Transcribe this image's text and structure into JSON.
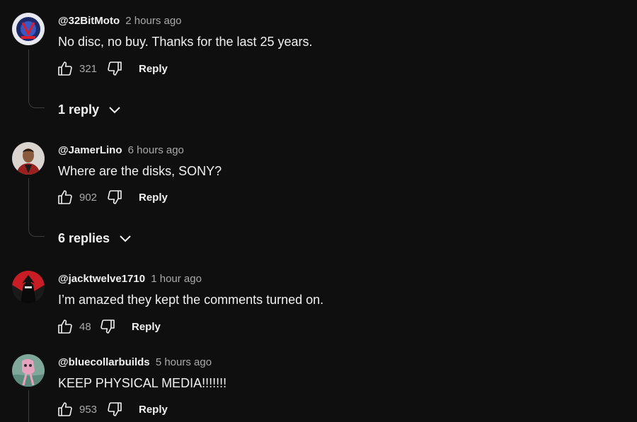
{
  "comments": [
    {
      "author": "@32BitMoto",
      "time": "2 hours ago",
      "text": "No disc, no buy. Thanks for the last 25 years.",
      "likes": "321",
      "reply_label": "Reply",
      "replies_label": "1 reply"
    },
    {
      "author": "@JamerLino",
      "time": "6 hours ago",
      "text": "Where are the disks, SONY?",
      "likes": "902",
      "reply_label": "Reply",
      "replies_label": "6 replies"
    },
    {
      "author": "@jacktwelve1710",
      "time": "1 hour ago",
      "text": "I’m amazed they kept the comments turned on.",
      "likes": "48",
      "reply_label": "Reply"
    },
    {
      "author": "@bluecollarbuilds",
      "time": "5 hours ago",
      "text": "KEEP PHYSICAL MEDIA!!!!!!!",
      "likes": "953",
      "reply_label": "Reply"
    }
  ],
  "icons": {
    "like": "thumbs-up-icon",
    "dislike": "thumbs-down-icon",
    "expand": "chevron-down-icon"
  },
  "colors": {
    "background": "#0f0f0f",
    "text_primary": "#f1f1f1",
    "text_secondary": "#aaaaaa",
    "thread_line": "#3d3d3d"
  }
}
